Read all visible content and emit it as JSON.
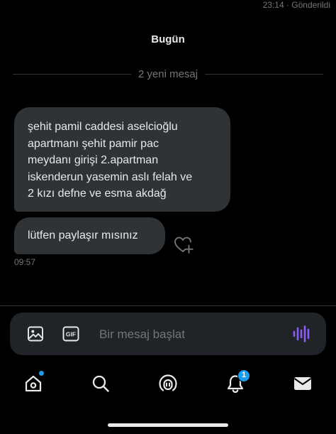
{
  "status": {
    "sent_meta": "23:14 · Gönderildi"
  },
  "conversation": {
    "date_label": "Bugün",
    "new_messages_label": "2 yeni mesaj",
    "messages": [
      {
        "text": "şehit pamil caddesi aselcioğlu\napartmanı  şehit pamir pac\nmeydanı girişi 2.apartman\niskenderun yasemin aslı felah ve\n2 kızı defne ve esma akdağ"
      },
      {
        "text": "lütfen paylaşır mısınız"
      }
    ],
    "last_time": "09:57"
  },
  "composer": {
    "placeholder": "Bir mesaj başlat",
    "value": "",
    "gif_label": "GIF"
  },
  "tabbar": {
    "notifications_badge": "1",
    "icons": [
      "home-icon",
      "search-icon",
      "spaces-icon",
      "bell-icon",
      "envelope-icon"
    ]
  },
  "colors": {
    "background": "#000000",
    "bubble": "#2f3336",
    "text": "#e7e9ea",
    "muted": "#71767b",
    "accent_blue": "#1d9bf0",
    "voice_purple": "#8b5cf6",
    "composer_bg": "#202327"
  }
}
